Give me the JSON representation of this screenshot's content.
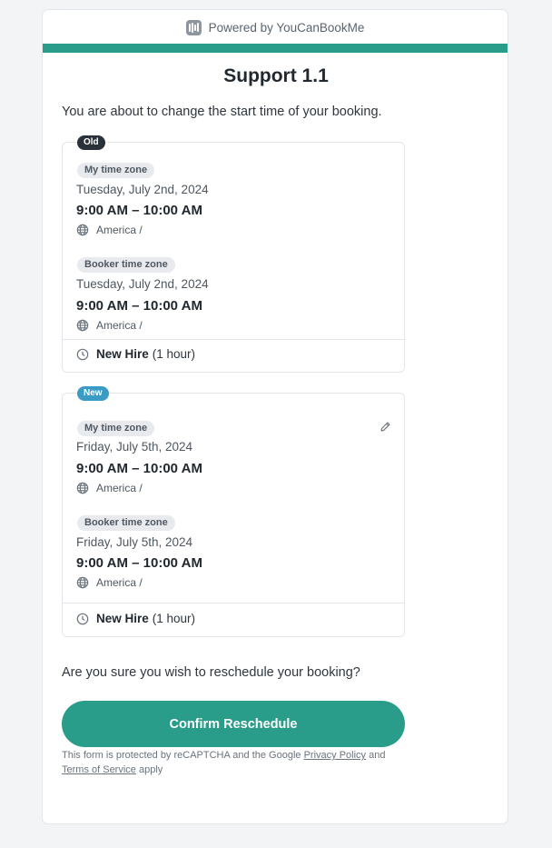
{
  "header": {
    "powered_by": "Powered by YouCanBookMe",
    "logo_icon": "youcanbookme-logo-icon",
    "accent_color": "#2a9d8a"
  },
  "title": "Support 1.1",
  "intro": "You are about to change the start time of your booking.",
  "old_booking": {
    "tag": "Old",
    "tag_color": "#2b3138",
    "my_tz": {
      "label": "My time zone",
      "date": "Tuesday, July 2nd, 2024",
      "time": "9:00 AM – 10:00 AM",
      "zone": "America /"
    },
    "booker_tz": {
      "label": "Booker time zone",
      "date": "Tuesday, July 2nd, 2024",
      "time": "9:00 AM – 10:00 AM",
      "zone": "America /"
    },
    "type_name": "New Hire",
    "duration": "(1 hour)"
  },
  "new_booking": {
    "tag": "New",
    "tag_color": "#3a9cc5",
    "my_tz": {
      "label": "My time zone",
      "date": "Friday, July 5th, 2024",
      "time": "9:00 AM – 10:00 AM",
      "zone": "America /"
    },
    "booker_tz": {
      "label": "Booker time zone",
      "date": "Friday, July 5th, 2024",
      "time": "9:00 AM – 10:00 AM",
      "zone": "America /"
    },
    "type_name": "New Hire",
    "duration": "(1 hour)"
  },
  "question": "Are you sure you wish to reschedule your booking?",
  "confirm_button": "Confirm Reschedule",
  "button_color": "#2a9d8a",
  "legal": {
    "prefix": "This form is protected by reCAPTCHA and the Google",
    "privacy_link": "Privacy Policy",
    "and": "and",
    "terms_link": "Terms of Service",
    "suffix": "apply"
  }
}
